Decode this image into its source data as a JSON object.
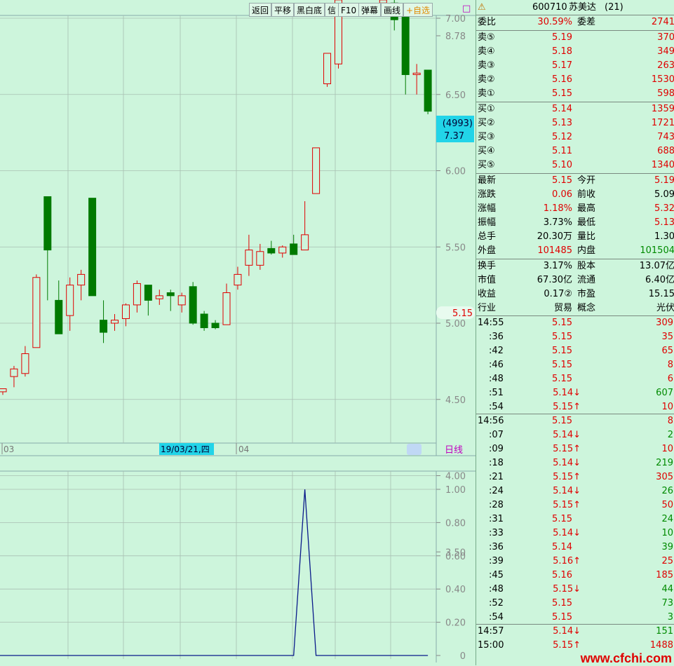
{
  "toolbar": {
    "buttons": [
      "返回",
      "平移",
      "黑白底",
      "信",
      "F10",
      "弹幕",
      "画线"
    ],
    "watchlist": "+自选",
    "box_icon": "□"
  },
  "chart_data": [
    {
      "type": "candlestick",
      "title": "",
      "ylim": [
        3.5,
        8.78
      ],
      "yticks": [
        "8.78",
        "8.50",
        "8.00",
        "7.50",
        "7.00",
        "6.50",
        "6.00",
        "5.50",
        "5.00",
        "4.50",
        "4.00",
        "3.50"
      ],
      "date_labels": [
        "03",
        "04"
      ],
      "cursor_date": "19/03/21,四",
      "cursor_volume": "(4993)",
      "cursor_price": "7.37",
      "last_price_tag": "5.15",
      "max_label": "8.78",
      "period_label": "日线",
      "candles": [
        {
          "o": 4.55,
          "h": 4.57,
          "l": 4.53,
          "c": 4.57
        },
        {
          "o": 4.65,
          "h": 4.72,
          "l": 4.58,
          "c": 4.7
        },
        {
          "o": 4.67,
          "h": 4.85,
          "l": 4.65,
          "c": 4.8
        },
        {
          "o": 4.84,
          "h": 5.32,
          "l": 4.84,
          "c": 5.3
        },
        {
          "o": 5.83,
          "h": 5.83,
          "l": 5.15,
          "c": 5.48
        },
        {
          "o": 5.15,
          "h": 5.28,
          "l": 4.93,
          "c": 4.93
        },
        {
          "o": 5.05,
          "h": 5.3,
          "l": 4.95,
          "c": 5.25
        },
        {
          "o": 5.25,
          "h": 5.35,
          "l": 5.15,
          "c": 5.32
        },
        {
          "o": 5.82,
          "h": 5.82,
          "l": 5.18,
          "c": 5.18
        },
        {
          "o": 5.02,
          "h": 5.15,
          "l": 4.87,
          "c": 4.94
        },
        {
          "o": 5.0,
          "h": 5.06,
          "l": 4.95,
          "c": 5.02
        },
        {
          "o": 5.03,
          "h": 5.13,
          "l": 4.98,
          "c": 5.12
        },
        {
          "o": 5.12,
          "h": 5.28,
          "l": 5.07,
          "c": 5.26
        },
        {
          "o": 5.25,
          "h": 5.25,
          "l": 5.05,
          "c": 5.15
        },
        {
          "o": 5.16,
          "h": 5.22,
          "l": 5.12,
          "c": 5.18
        },
        {
          "o": 5.2,
          "h": 5.22,
          "l": 5.08,
          "c": 5.18
        },
        {
          "o": 5.12,
          "h": 5.2,
          "l": 5.07,
          "c": 5.18
        },
        {
          "o": 5.24,
          "h": 5.27,
          "l": 4.99,
          "c": 5.0
        },
        {
          "o": 5.06,
          "h": 5.08,
          "l": 4.95,
          "c": 4.97
        },
        {
          "o": 5.0,
          "h": 5.02,
          "l": 4.96,
          "c": 4.97
        },
        {
          "o": 4.99,
          "h": 5.26,
          "l": 4.99,
          "c": 5.2
        },
        {
          "o": 5.25,
          "h": 5.37,
          "l": 5.22,
          "c": 5.32
        },
        {
          "o": 5.38,
          "h": 5.58,
          "l": 5.31,
          "c": 5.48
        },
        {
          "o": 5.38,
          "h": 5.52,
          "l": 5.35,
          "c": 5.47
        },
        {
          "o": 5.49,
          "h": 5.54,
          "l": 5.45,
          "c": 5.46
        },
        {
          "o": 5.46,
          "h": 5.51,
          "l": 5.43,
          "c": 5.5
        },
        {
          "o": 5.52,
          "h": 5.58,
          "l": 5.45,
          "c": 5.45
        },
        {
          "o": 5.48,
          "h": 5.8,
          "l": 5.48,
          "c": 5.58
        },
        {
          "o": 5.85,
          "h": 6.15,
          "l": 5.85,
          "c": 6.15
        },
        {
          "o": 6.57,
          "h": 6.77,
          "l": 6.55,
          "c": 6.77
        },
        {
          "o": 6.7,
          "h": 7.37,
          "l": 6.67,
          "c": 7.12
        },
        {
          "o": 7.65,
          "h": 8.22,
          "l": 7.62,
          "c": 8.22
        },
        {
          "o": 8.78,
          "h": 8.78,
          "l": 7.95,
          "c": 7.97
        },
        {
          "o": 7.59,
          "h": 7.77,
          "l": 7.2,
          "c": 7.21
        },
        {
          "o": 7.1,
          "h": 7.32,
          "l": 7.07,
          "c": 7.12
        },
        {
          "o": 7.1,
          "h": 7.25,
          "l": 6.92,
          "c": 6.99
        },
        {
          "o": 7.03,
          "h": 7.03,
          "l": 6.5,
          "c": 6.63
        },
        {
          "o": 6.63,
          "h": 6.7,
          "l": 6.5,
          "c": 6.64
        },
        {
          "o": 6.66,
          "h": 6.66,
          "l": 6.37,
          "c": 6.39
        }
      ]
    },
    {
      "type": "line",
      "title": "",
      "ylim": [
        0,
        1.0
      ],
      "yticks": [
        "1.00",
        "0.80",
        "0.60",
        "0.40",
        "0.20",
        "0"
      ],
      "values": [
        0,
        0,
        0,
        0,
        0,
        0,
        0,
        0,
        0,
        0,
        0,
        0,
        0,
        0,
        0,
        0,
        0,
        0,
        0,
        0,
        0,
        0,
        0,
        0,
        0,
        0,
        0,
        1.0,
        0,
        0,
        0,
        0,
        0,
        0,
        0,
        0,
        0,
        0,
        0
      ]
    }
  ],
  "quote": {
    "warn_icon": "⚠",
    "code": "600710",
    "name": "苏美达",
    "period": "(21)",
    "webi_label": "委比",
    "webi_value": "30.59%",
    "weicha_label": "委差",
    "weicha_value": "2741",
    "sells": [
      {
        "label": "卖⑤",
        "price": "5.19",
        "vol": "370"
      },
      {
        "label": "卖④",
        "price": "5.18",
        "vol": "349"
      },
      {
        "label": "卖③",
        "price": "5.17",
        "vol": "263"
      },
      {
        "label": "卖②",
        "price": "5.16",
        "vol": "1530"
      },
      {
        "label": "卖①",
        "price": "5.15",
        "vol": "598"
      }
    ],
    "buys": [
      {
        "label": "买①",
        "price": "5.14",
        "vol": "1359"
      },
      {
        "label": "买②",
        "price": "5.13",
        "vol": "1721"
      },
      {
        "label": "买③",
        "price": "5.12",
        "vol": "743"
      },
      {
        "label": "买④",
        "price": "5.11",
        "vol": "688"
      },
      {
        "label": "买⑤",
        "price": "5.10",
        "vol": "1340"
      }
    ],
    "stats": [
      {
        "l1": "最新",
        "v1": "5.15",
        "c1": "red",
        "l2": "今开",
        "v2": "5.19",
        "c2": "red"
      },
      {
        "l1": "涨跌",
        "v1": "0.06",
        "c1": "red",
        "l2": "前收",
        "v2": "5.09",
        "c2": "black"
      },
      {
        "l1": "涨幅",
        "v1": "1.18%",
        "c1": "red",
        "l2": "最高",
        "v2": "5.32",
        "c2": "red"
      },
      {
        "l1": "振幅",
        "v1": "3.73%",
        "c1": "black",
        "l2": "最低",
        "v2": "5.13",
        "c2": "red"
      },
      {
        "l1": "总手",
        "v1": "20.30万",
        "c1": "black",
        "l2": "量比",
        "v2": "1.30",
        "c2": "black"
      },
      {
        "l1": "外盘",
        "v1": "101485",
        "c1": "red",
        "l2": "内盘",
        "v2": "101504",
        "c2": "grn"
      }
    ],
    "stats2": [
      {
        "l1": "换手",
        "v1": "3.17%",
        "l2": "股本",
        "v2": "13.07亿"
      },
      {
        "l1": "市值",
        "v1": "67.30亿",
        "l2": "流通",
        "v2": "6.40亿"
      },
      {
        "l1": "收益",
        "v1": "0.17②",
        "l2": "市盈",
        "v2": "15.15"
      },
      {
        "l1": "行业",
        "v1": "贸易",
        "l2": "概念",
        "v2": "光伏"
      }
    ],
    "ticks": [
      {
        "t": "14:55",
        "p": "5.15",
        "v": "309",
        "c": "red",
        "sep": false
      },
      {
        "t": ":36",
        "p": "5.15",
        "v": "35",
        "c": "red",
        "sep": false
      },
      {
        "t": ":42",
        "p": "5.15",
        "v": "65",
        "c": "red",
        "sep": false
      },
      {
        "t": ":46",
        "p": "5.15",
        "v": "8",
        "c": "red",
        "sep": false
      },
      {
        "t": ":48",
        "p": "5.15",
        "v": "6",
        "c": "red",
        "sep": false
      },
      {
        "t": ":51",
        "p": "5.14↓",
        "v": "607",
        "c": "grn",
        "sep": false
      },
      {
        "t": ":54",
        "p": "5.15↑",
        "v": "10",
        "c": "red",
        "sep": false
      },
      {
        "t": "14:56",
        "p": "5.15",
        "v": "8",
        "c": "red",
        "sep": true
      },
      {
        "t": ":07",
        "p": "5.14↓",
        "v": "2",
        "c": "grn",
        "sep": false
      },
      {
        "t": ":09",
        "p": "5.15↑",
        "v": "10",
        "c": "red",
        "sep": false
      },
      {
        "t": ":18",
        "p": "5.14↓",
        "v": "219",
        "c": "grn",
        "sep": false
      },
      {
        "t": ":21",
        "p": "5.15↑",
        "v": "305",
        "c": "red",
        "sep": false
      },
      {
        "t": ":24",
        "p": "5.14↓",
        "v": "26",
        "c": "grn",
        "sep": false
      },
      {
        "t": ":28",
        "p": "5.15↑",
        "v": "50",
        "c": "red",
        "sep": false
      },
      {
        "t": ":31",
        "p": "5.15",
        "v": "24",
        "c": "grn",
        "sep": false
      },
      {
        "t": ":33",
        "p": "5.14↓",
        "v": "10",
        "c": "grn",
        "sep": false
      },
      {
        "t": ":36",
        "p": "5.14",
        "v": "39",
        "c": "grn",
        "sep": false
      },
      {
        "t": ":39",
        "p": "5.16↑",
        "v": "25",
        "c": "red",
        "sep": false
      },
      {
        "t": ":45",
        "p": "5.16",
        "v": "185",
        "c": "red",
        "sep": false
      },
      {
        "t": ":48",
        "p": "5.15↓",
        "v": "44",
        "c": "grn",
        "sep": false
      },
      {
        "t": ":52",
        "p": "5.15",
        "v": "73",
        "c": "grn",
        "sep": false
      },
      {
        "t": ":54",
        "p": "5.15",
        "v": "3",
        "c": "grn",
        "sep": false
      },
      {
        "t": "14:57",
        "p": "5.14↓",
        "v": "151",
        "c": "grn",
        "sep": true
      },
      {
        "t": "15:00",
        "p": "5.15↑",
        "v": "1488",
        "c": "red",
        "sep": false
      }
    ],
    "watermark": "www.cfchi.com"
  },
  "colors": {
    "bg": "#cdf5dc",
    "up": "#e00000",
    "down": "#007a00",
    "grid": "#a9bfb2",
    "cursor_bg": "#22d4e8",
    "navy": "#0a1a8a"
  }
}
